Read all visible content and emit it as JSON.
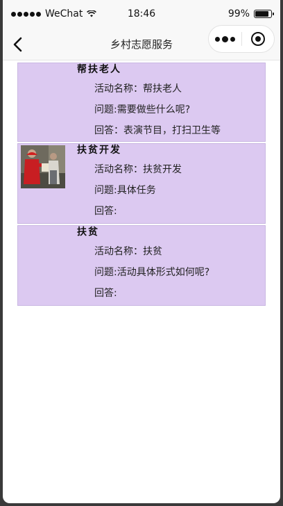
{
  "status_bar": {
    "carrier": "WeChat",
    "time": "18:46",
    "battery": "99%"
  },
  "nav": {
    "title": "乡村志愿服务"
  },
  "activities": [
    {
      "title": "帮扶老人",
      "name_line": "活动名称：帮扶老人",
      "question_line": "问题:需要做些什么呢?",
      "answer_line": "回答：表演节目，打扫卫生等"
    },
    {
      "title": "扶贫开发",
      "name_line": "活动名称：扶贫开发",
      "question_line": "问题:具体任务",
      "answer_line": "回答:"
    },
    {
      "title": "扶贫",
      "name_line": "活动名称：扶贫",
      "question_line": "问题:活动具体形式如何呢?",
      "answer_line": "回答:"
    }
  ],
  "colors": {
    "card_bg": "#dcc9f1"
  }
}
